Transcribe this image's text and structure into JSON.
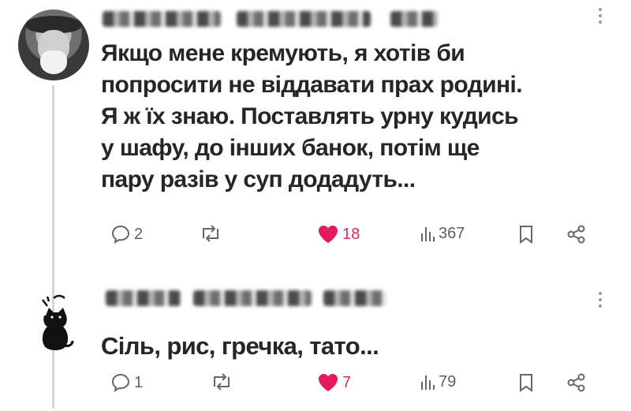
{
  "posts": [
    {
      "avatar": "old-man-photo",
      "author_blurred": true,
      "text": "Якщо мене кремують, я хотів би\nпопросити не віддавати прах родині.\nЯ ж їх знаю. Поставлять урну кудись\nу шафу, до інших банок, потім ще\nпару разів у суп додадуть...",
      "replies": "2",
      "likes": "18",
      "views": "367"
    },
    {
      "avatar": "black-cat-silhouette",
      "author_blurred": true,
      "text": "Сіль, рис, гречка, тато...",
      "replies": "1",
      "likes": "7",
      "views": "79"
    }
  ],
  "icons": {
    "reply": "speech-bubble-icon",
    "repost": "repost-arrows-icon",
    "like": "heart-icon",
    "views": "bar-chart-icon",
    "bookmark": "bookmark-icon",
    "share": "share-icon",
    "more": "more-dots-icon"
  },
  "colors": {
    "like": "#e31b5d",
    "text": "#262626",
    "muted": "#666666"
  }
}
